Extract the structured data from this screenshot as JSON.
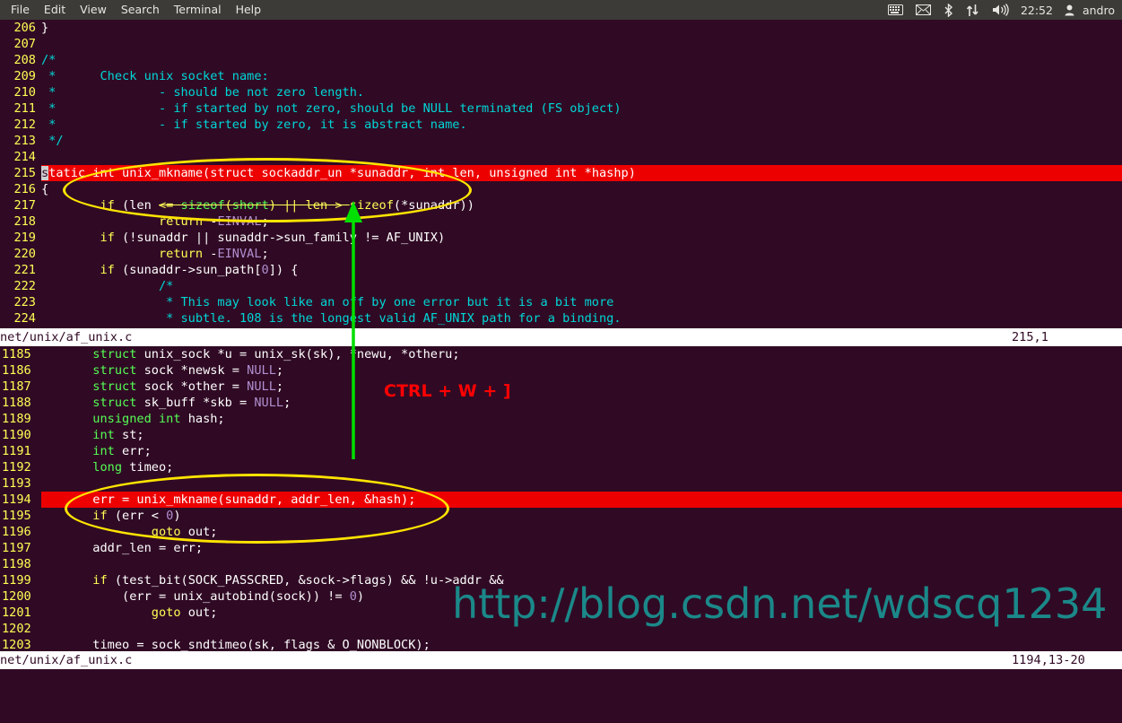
{
  "window": {
    "menu": [
      {
        "label": "File",
        "name": "menu-file"
      },
      {
        "label": "Edit",
        "name": "menu-edit"
      },
      {
        "label": "View",
        "name": "menu-view"
      },
      {
        "label": "Search",
        "name": "menu-search"
      },
      {
        "label": "Terminal",
        "name": "menu-terminal"
      },
      {
        "label": "Help",
        "name": "menu-help"
      }
    ],
    "tray": {
      "icons": [
        "keyboard-icon",
        "mail-icon",
        "bluetooth-icon",
        "network-icon",
        "volume-icon"
      ],
      "clock": "22:52",
      "user": "andro"
    }
  },
  "editor": {
    "top_pane": {
      "lines": [
        {
          "num": "206",
          "text": "}"
        },
        {
          "num": "207",
          "text": ""
        },
        {
          "num": "208",
          "text": "/*"
        },
        {
          "num": "209",
          "text": " *      Check unix socket name:"
        },
        {
          "num": "210",
          "text": " *              - should be not zero length."
        },
        {
          "num": "211",
          "text": " *              - if started by not zero, should be NULL terminated (FS object)"
        },
        {
          "num": "212",
          "text": " *              - if started by zero, it is abstract name."
        },
        {
          "num": "213",
          "text": " */"
        },
        {
          "num": "214",
          "text": ""
        },
        {
          "num": "215",
          "text": "static int unix_mkname(struct sockaddr_un *sunaddr, int len, unsigned int *hashp)"
        },
        {
          "num": "216",
          "text": "{"
        },
        {
          "num": "217",
          "text": "        if (len <= sizeof(short) || len > sizeof(*sunaddr))"
        },
        {
          "num": "218",
          "text": "                return -EINVAL;"
        },
        {
          "num": "219",
          "text": "        if (!sunaddr || sunaddr->sun_family != AF_UNIX)"
        },
        {
          "num": "220",
          "text": "                return -EINVAL;"
        },
        {
          "num": "221",
          "text": "        if (sunaddr->sun_path[0]) {"
        },
        {
          "num": "222",
          "text": "                /*"
        },
        {
          "num": "223",
          "text": "                 * This may look like an off by one error but it is a bit more"
        },
        {
          "num": "224",
          "text": "                 * subtle. 108 is the longest valid AF_UNIX path for a binding."
        }
      ],
      "status": {
        "file": "net/unix/af_unix.c",
        "position": "215,1"
      }
    },
    "bottom_pane": {
      "lines": [
        {
          "num": "1185",
          "text": "        struct unix_sock *u = unix_sk(sk), *newu, *otheru;"
        },
        {
          "num": "1186",
          "text": "        struct sock *newsk = NULL;"
        },
        {
          "num": "1187",
          "text": "        struct sock *other = NULL;"
        },
        {
          "num": "1188",
          "text": "        struct sk_buff *skb = NULL;"
        },
        {
          "num": "1189",
          "text": "        unsigned int hash;"
        },
        {
          "num": "1190",
          "text": "        int st;"
        },
        {
          "num": "1191",
          "text": "        int err;"
        },
        {
          "num": "1192",
          "text": "        long timeo;"
        },
        {
          "num": "1193",
          "text": ""
        },
        {
          "num": "1194",
          "text": "        err = unix_mkname(sunaddr, addr_len, &hash);"
        },
        {
          "num": "1195",
          "text": "        if (err < 0)"
        },
        {
          "num": "1196",
          "text": "                goto out;"
        },
        {
          "num": "1197",
          "text": "        addr_len = err;"
        },
        {
          "num": "1198",
          "text": ""
        },
        {
          "num": "1199",
          "text": "        if (test_bit(SOCK_PASSCRED, &sock->flags) && !u->addr &&"
        },
        {
          "num": "1200",
          "text": "            (err = unix_autobind(sock)) != 0)"
        },
        {
          "num": "1201",
          "text": "                goto out;"
        },
        {
          "num": "1202",
          "text": ""
        },
        {
          "num": "1203",
          "text": "        timeo = sock_sndtimeo(sk, flags & O_NONBLOCK);"
        }
      ],
      "status": {
        "file": "net/unix/af_unix.c",
        "position": "1194,13-20"
      }
    }
  },
  "annotations": {
    "keystroke_hint": "CTRL + W + ]",
    "watermark": "http://blog.csdn.net/wdscq1234",
    "ellipse_top_label": "highlight-function-definition",
    "ellipse_bottom_label": "highlight-function-call",
    "arrow_label": "jump-arrow"
  },
  "colors": {
    "background": "#300a24",
    "menubar": "#3c3b37",
    "highlight": "#ed0000",
    "ellipse": "#ffe400",
    "arrow": "#00e000",
    "hint": "#ff0000",
    "watermark": "#1a8f8f",
    "linenumber": "#ffff55",
    "comment": "#00d7d7"
  }
}
